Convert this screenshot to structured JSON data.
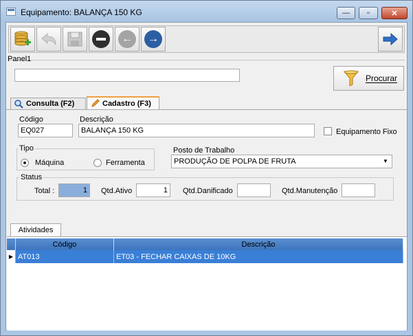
{
  "window": {
    "title": "Equipamento: BALANÇA 150 KG"
  },
  "window_controls": {
    "minimize": "—",
    "maximize": "▫",
    "close": "✕"
  },
  "toolbar": {
    "buttons": [
      {
        "icon": "database-add-icon",
        "enabled": true
      },
      {
        "icon": "undo-icon",
        "enabled": false
      },
      {
        "icon": "save-icon",
        "enabled": false
      },
      {
        "icon": "delete-icon",
        "enabled": true
      },
      {
        "icon": "previous-icon",
        "enabled": false
      },
      {
        "icon": "next-icon",
        "enabled": true
      }
    ],
    "exit_icon": "exit-arrow-icon"
  },
  "panel": {
    "label": "Panel1",
    "search_value": "",
    "search_button": "Procurar"
  },
  "tabs": [
    {
      "label": "Consulta (F2)",
      "active": false
    },
    {
      "label": "Cadastro (F3)",
      "active": true
    }
  ],
  "form": {
    "codigo_label": "Código",
    "codigo_value": "EQ027",
    "descricao_label": "Descrição",
    "descricao_value": "BALANÇA 150 KG",
    "equipamento_fixo_label": "Equipamento Fixo",
    "equipamento_fixo_checked": false,
    "tipo_label": "Tipo",
    "tipo_options": [
      "Máquina",
      "Ferramenta"
    ],
    "tipo_selected": "Máquina",
    "posto_label": "Posto de Trabalho",
    "posto_value": "PRODUÇÃO DE POLPA DE FRUTA",
    "status_label": "Status",
    "total_label": "Total :",
    "total_value": "1",
    "qtd_ativo_label": "Qtd.Ativo",
    "qtd_ativo_value": "1",
    "qtd_danificado_label": "Qtd.Danificado",
    "qtd_danificado_value": "",
    "qtd_manutencao_label": "Qtd.Manutenção",
    "qtd_manutencao_value": ""
  },
  "atividades": {
    "tab_label": "Atividades",
    "columns": [
      "Código",
      "Descrição"
    ],
    "rows": [
      {
        "codigo": "AT013",
        "descricao": "ET03 - FECHAR CAIXAS DE 10KG"
      }
    ]
  },
  "colors": {
    "title_bar": "#aac6e4",
    "grid_header": "#4a83c8",
    "selected_row": "#3a7fd6",
    "total_field": "#8aaedb"
  }
}
